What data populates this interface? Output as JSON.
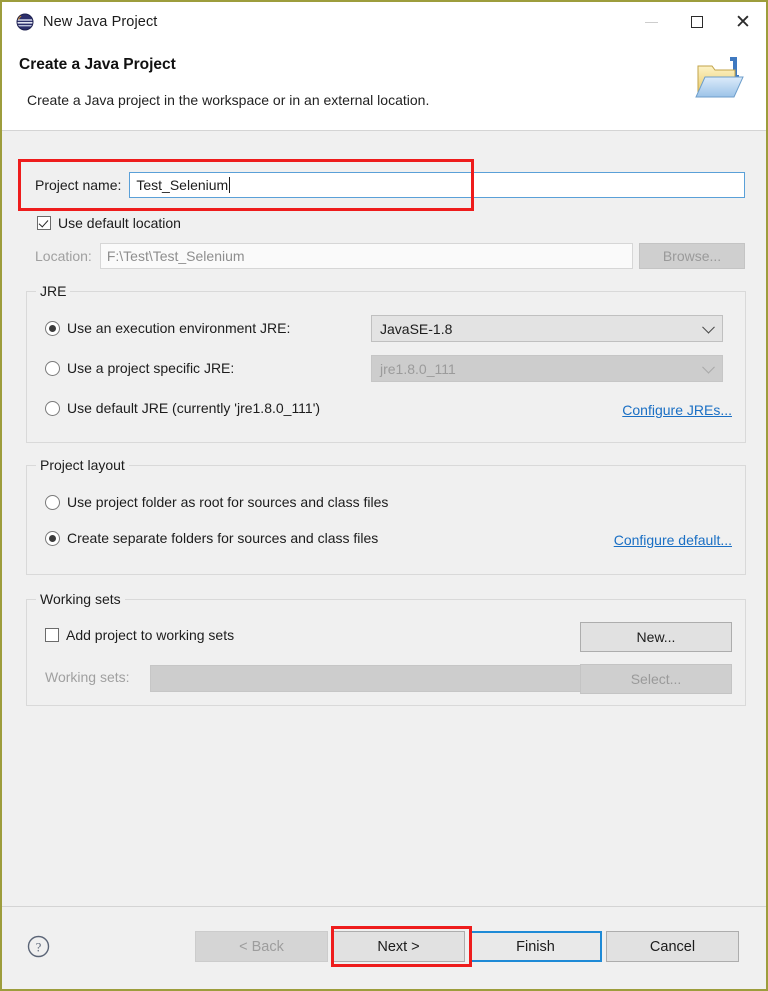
{
  "window": {
    "title": "New Java Project",
    "icon": "java-project-icon",
    "controls": {
      "minimize": "minimize-icon",
      "maximize": "maximize-icon",
      "close": "close-icon"
    }
  },
  "header": {
    "title": "Create a Java Project",
    "description": "Create a Java project in the workspace or in an external location.",
    "icon": "new-java-project-folder-icon"
  },
  "form": {
    "project_name": {
      "label": "Project name:",
      "value": "Test_Selenium",
      "placeholder": ""
    },
    "use_default_location": {
      "label": "Use default location",
      "checked": true
    },
    "location": {
      "label": "Location:",
      "value": "F:\\Test\\Test_Selenium",
      "browse_label": "Browse...",
      "enabled": false
    }
  },
  "jre": {
    "group_title": "JRE",
    "options": [
      {
        "label": "Use an execution environment JRE:",
        "selected": true,
        "combo_value": "JavaSE-1.8",
        "combo_enabled": true
      },
      {
        "label": "Use a project specific JRE:",
        "selected": false,
        "combo_value": "jre1.8.0_111",
        "combo_enabled": false
      },
      {
        "label": "Use default JRE (currently 'jre1.8.0_111')",
        "selected": false
      }
    ],
    "configure_link": "Configure JREs..."
  },
  "project_layout": {
    "group_title": "Project layout",
    "options": [
      {
        "label": "Use project folder as root for sources and class files",
        "selected": false
      },
      {
        "label": "Create separate folders for sources and class files",
        "selected": true
      }
    ],
    "configure_link": "Configure default..."
  },
  "working_sets": {
    "group_title": "Working sets",
    "add_checkbox": {
      "label": "Add project to working sets",
      "checked": false
    },
    "new_button": "New...",
    "sets_label": "Working sets:",
    "sets_value": "",
    "select_button": "Select..."
  },
  "footer": {
    "help_icon": "help-icon",
    "buttons": [
      {
        "label": "< Back",
        "state": "disabled"
      },
      {
        "label": "Next >",
        "state": "normal"
      },
      {
        "label": "Finish",
        "state": "default"
      },
      {
        "label": "Cancel",
        "state": "normal"
      }
    ]
  },
  "annotations": {
    "accent_color": "#ee1c1c",
    "highlighted": [
      "project-name-field",
      "next-button"
    ]
  },
  "colors": {
    "window_border": "#9d9d3c",
    "dialog_background": "#f0f0f0",
    "link": "#1a6fc4",
    "focus_border": "#5aa0d8",
    "default_button_border": "#1e8ad6",
    "annotation": "#ee1c1c"
  }
}
